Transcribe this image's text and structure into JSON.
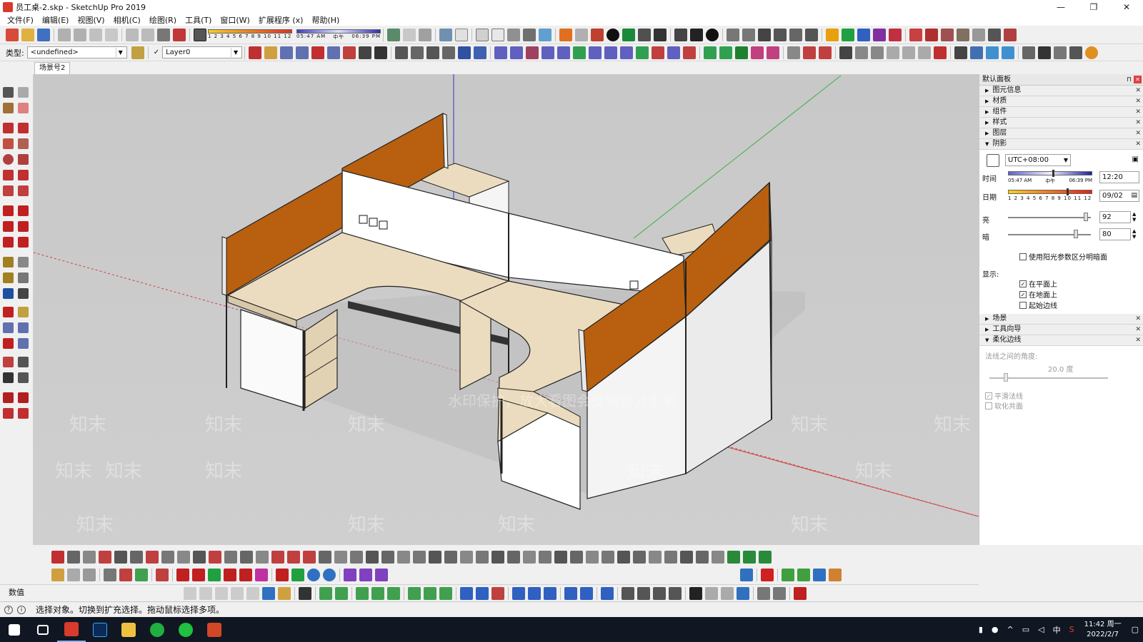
{
  "window": {
    "title": "员工桌-2.skp - SketchUp Pro 2019",
    "controls": [
      "—",
      "❐",
      "✕"
    ]
  },
  "menu": [
    "文件(F)",
    "编辑(E)",
    "视图(V)",
    "相机(C)",
    "绘图(R)",
    "工具(T)",
    "窗口(W)",
    "扩展程序 (x)",
    "帮助(H)"
  ],
  "toolbar": {
    "shadow_time_start": "05:47 AM",
    "shadow_time_noon": "中午",
    "shadow_time_end": "06:39 PM",
    "month_ticks": "1 2 3 4 5 6 7 8 9 10 11 12",
    "type_label": "类型:",
    "type_value": "<undefined>",
    "layer_value": "Layer0"
  },
  "scene_tab": "场景号2",
  "panel": {
    "title": "默认面板",
    "trays_top": [
      "图元信息",
      "材质",
      "组件",
      "样式",
      "图层"
    ],
    "shadow_tray": "阴影",
    "timezone": "UTC+08:00",
    "time_label": "时间",
    "time_start": "05:47 AM",
    "time_noon": "中午",
    "time_end": "06:39 PM",
    "time_value": "12:20",
    "date_label": "日期",
    "month_ticks": "1 2 3 4 5 6 7 8 9 10 11 12",
    "date_value": "09/02",
    "light_label": "亮",
    "light_value": "92",
    "dark_label": "暗",
    "dark_value": "80",
    "use_sun_label": "使用阳光参数区分明暗面",
    "display_label": "显示:",
    "on_faces": "在平面上",
    "on_ground": "在地面上",
    "from_edges": "起始边线",
    "trays_bottom": [
      "场景",
      "工具向导"
    ],
    "soften_tray": "柔化边线",
    "normals_angle_label": "法线之间的角度:",
    "normals_angle_value": "20.0 度",
    "smooth_normals": "平滑法线",
    "soften_coplanar": "软化共面"
  },
  "measurements_label": "数值",
  "status_text": "选择对象。切换到扩充选择。拖动鼠标选择多项。",
  "viewport": {
    "watermark_brand": "知末",
    "watermark_notice": "水印保护，放大看图会受到部分影响"
  },
  "taskbar": {
    "time": "11:42 周一",
    "date": "2022/2/7",
    "ime": "中"
  },
  "colors": {
    "orange_panel": "#b8600f",
    "desk_top": "#ecdcbf",
    "sky": "#c9c9c9"
  }
}
